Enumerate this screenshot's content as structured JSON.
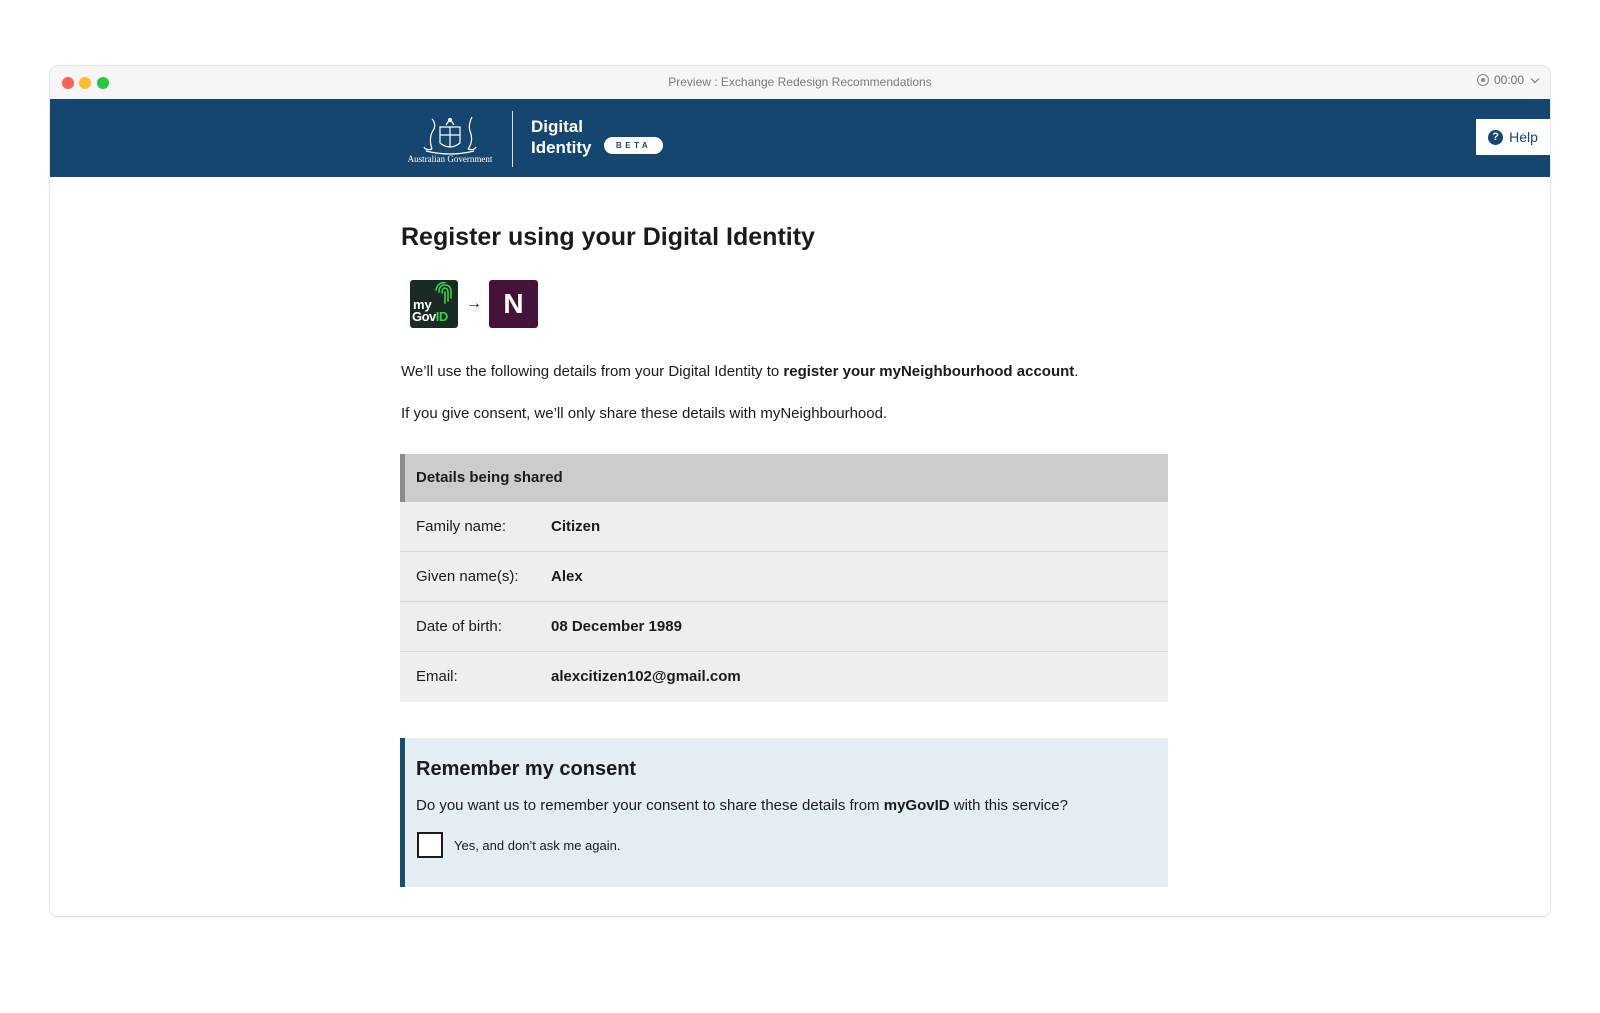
{
  "window": {
    "title": "Preview : Exchange Redesign Recommendations",
    "timer": "00:00"
  },
  "header": {
    "gov_label": "Australian Government",
    "title_line1": "Digital",
    "title_line2": "Identity",
    "badge": "BETA",
    "help_label": "Help",
    "background_color": "#154670"
  },
  "main": {
    "page_title": "Register using your Digital Identity",
    "logos": {
      "from_logo_my": "my",
      "from_logo_gov": "Gov",
      "from_logo_id": "ID",
      "arrow": "→",
      "to_logo_letter": "N"
    },
    "intro_text": "We’ll use the following details from your Digital Identity to ",
    "intro_bold": "register your myNeighbourhood account",
    "intro_end": ".",
    "consent_note": "If you give consent, we’ll only share these details with myNeighbourhood."
  },
  "details": {
    "heading": "Details being shared",
    "rows": [
      {
        "label": "Family name:",
        "value": "Citizen"
      },
      {
        "label": "Given name(s):",
        "value": "Alex"
      },
      {
        "label": "Date of birth:",
        "value": "08 December 1989"
      },
      {
        "label": "Email:",
        "value": "alexcitizen102@gmail.com"
      }
    ]
  },
  "consent": {
    "heading": "Remember my consent",
    "question_start": "Do you want us to remember your consent to share these details from ",
    "question_bold": "myGovID",
    "question_end": " with this service?",
    "checkbox_label": "Yes, and don’t ask me again.",
    "checkbox_checked": false
  },
  "colors": {
    "accent_green": "#37d34a",
    "service_purple": "#451238",
    "consent_border": "#14506d"
  }
}
